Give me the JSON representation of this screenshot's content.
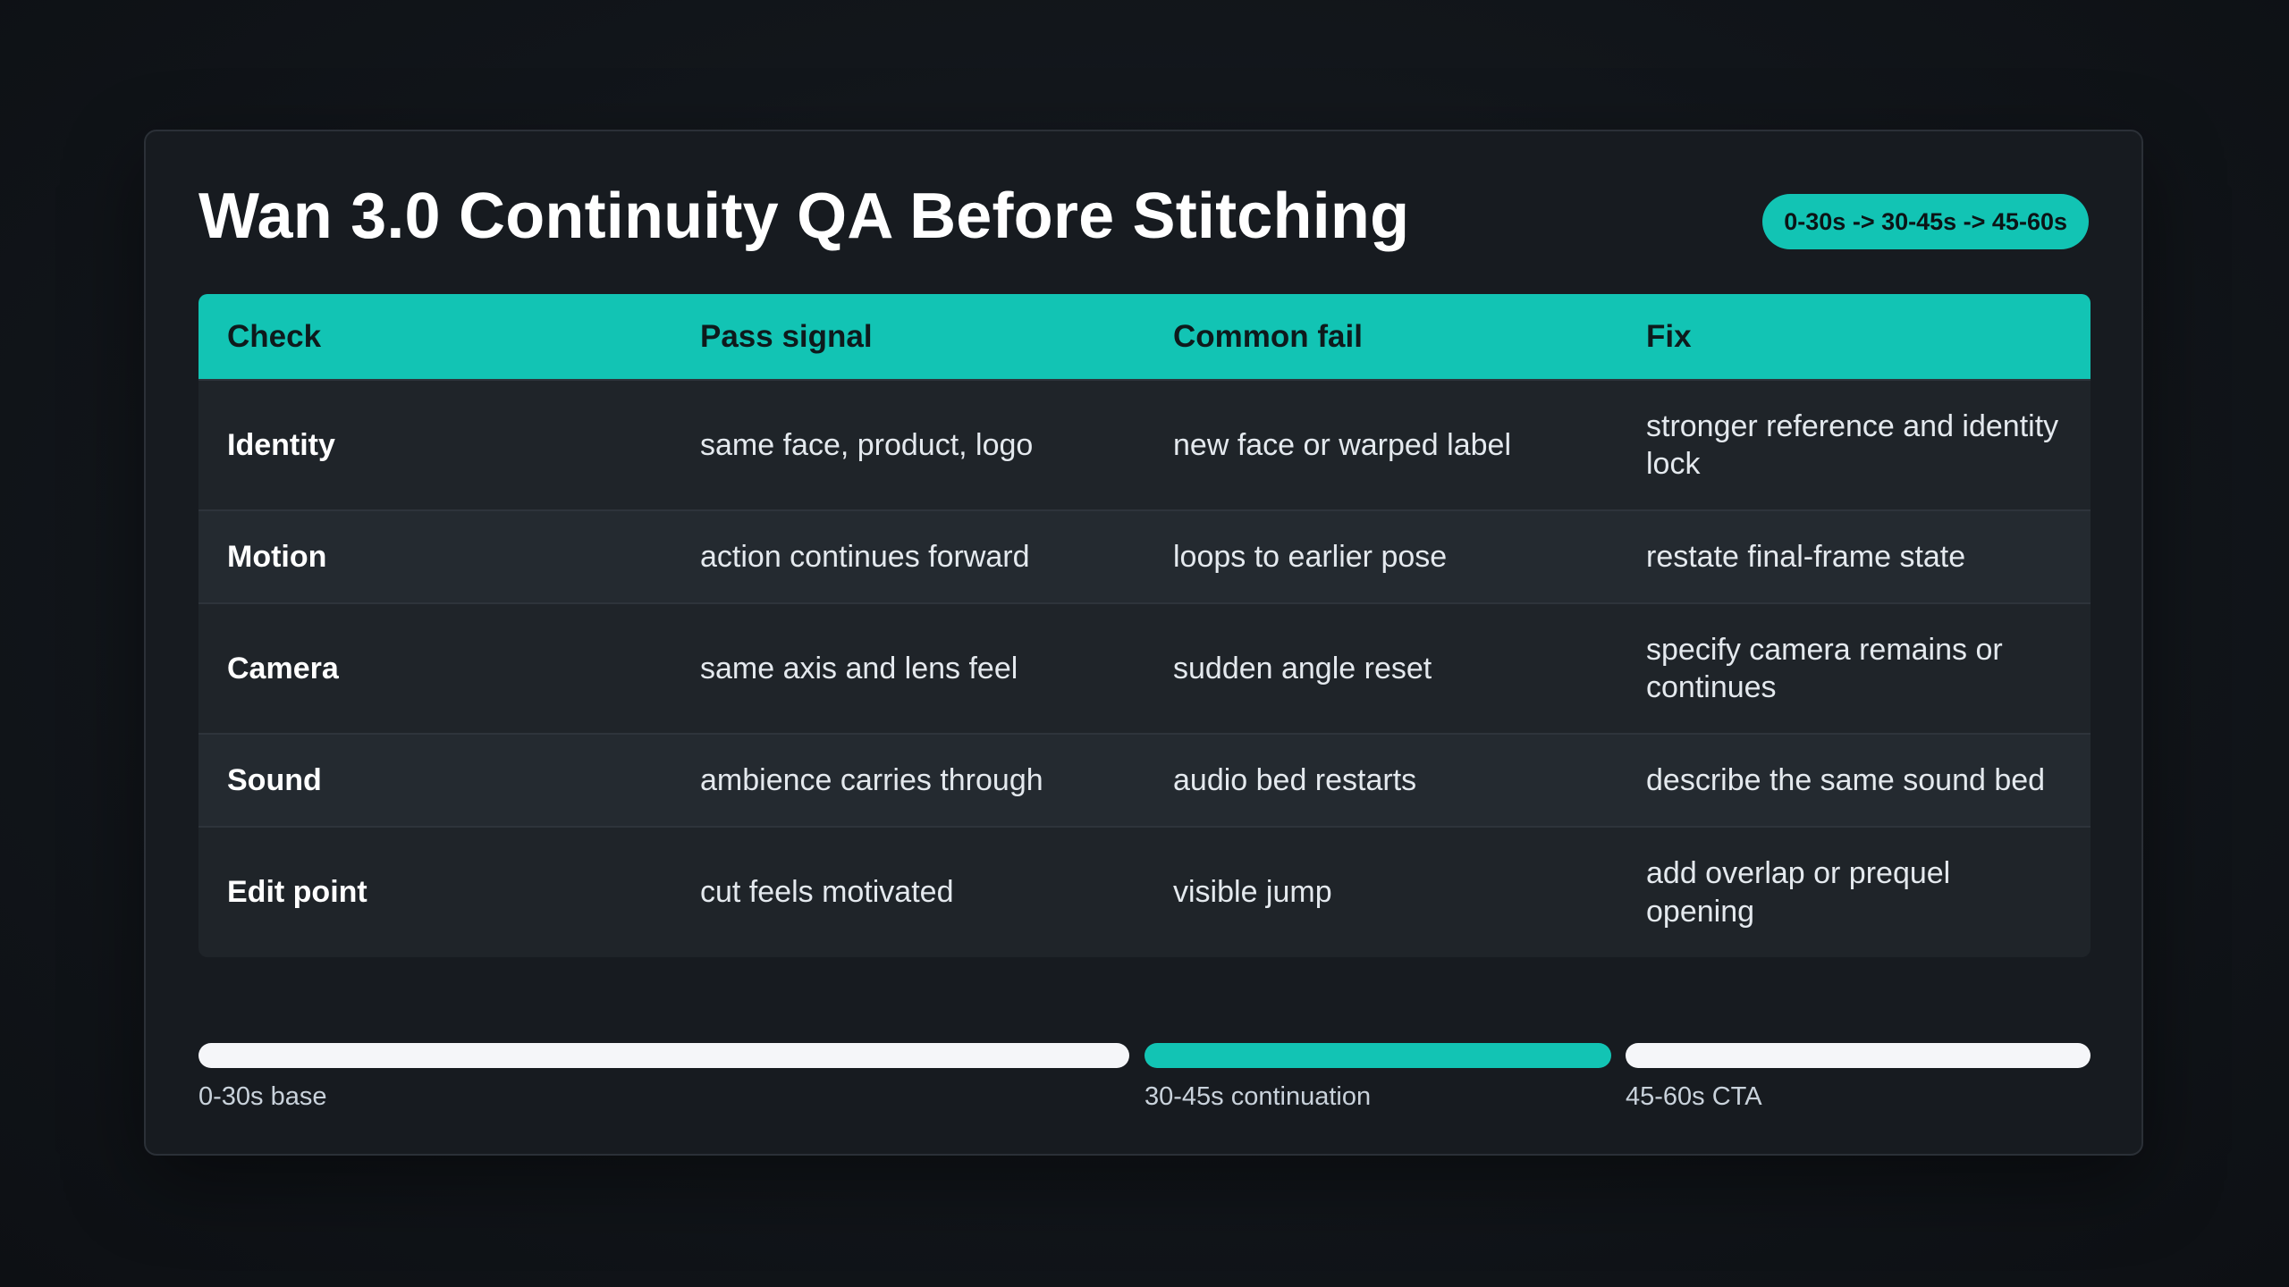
{
  "title": "Wan 3.0 Continuity QA Before Stitching",
  "badge": "0-30s -> 30-45s -> 45-60s",
  "colors": {
    "accent": "#12c4b4",
    "background": "#12161b",
    "card": "#171b20",
    "bar_white": "#f5f6f9"
  },
  "table": {
    "headers": [
      "Check",
      "Pass signal",
      "Common fail",
      "Fix"
    ],
    "rows": [
      {
        "check": "Identity",
        "pass": "same face, product, logo",
        "fail": "new face or warped label",
        "fix": "stronger reference and identity lock"
      },
      {
        "check": "Motion",
        "pass": "action continues forward",
        "fail": "loops to earlier pose",
        "fix": "restate final-frame state"
      },
      {
        "check": "Camera",
        "pass": "same axis and lens feel",
        "fail": "sudden angle reset",
        "fix": "specify camera remains or continues"
      },
      {
        "check": "Sound",
        "pass": "ambience carries through",
        "fail": "audio bed restarts",
        "fix": "describe the same sound bed"
      },
      {
        "check": "Edit point",
        "pass": "cut feels motivated",
        "fail": "visible jump",
        "fix": "add overlap or prequel opening"
      }
    ]
  },
  "timeline": {
    "segments": [
      {
        "label": "0-30s base",
        "color": "white"
      },
      {
        "label": "30-45s continuation",
        "color": "teal"
      },
      {
        "label": "45-60s CTA",
        "color": "white"
      }
    ]
  }
}
